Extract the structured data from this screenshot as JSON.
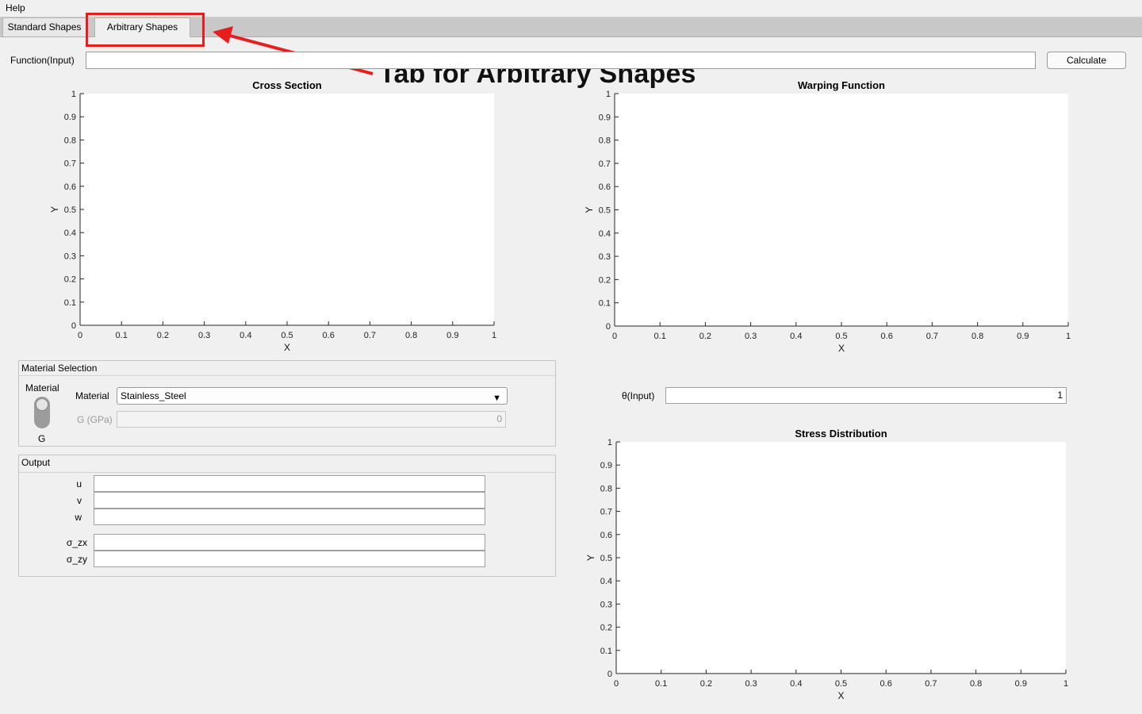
{
  "menu": {
    "help": "Help"
  },
  "tabs": [
    {
      "label": "Standard Shapes",
      "active": false
    },
    {
      "label": "Arbitrary Shapes",
      "active": true
    }
  ],
  "annotation": {
    "text": "Tab for Arbitrary Shapes",
    "color": "#e81e1e"
  },
  "function_input": {
    "label": "Function(Input)",
    "value": ""
  },
  "calculate_button": "Calculate",
  "ticks": [
    "0",
    "0.1",
    "0.2",
    "0.3",
    "0.4",
    "0.5",
    "0.6",
    "0.7",
    "0.8",
    "0.9",
    "1"
  ],
  "plots": {
    "cross_section": {
      "title": "Cross Section",
      "xlabel": "X",
      "ylabel": "Y"
    },
    "warping_function": {
      "title": "Warping Function",
      "xlabel": "X",
      "ylabel": "Y"
    },
    "stress_distribution": {
      "title": "Stress Distribution",
      "xlabel": "X",
      "ylabel": "Y"
    }
  },
  "material_panel": {
    "title": "Material Selection",
    "switch_top_label": "Material",
    "switch_bottom_label": "G",
    "material_label": "Material",
    "material_value": "Stainless_Steel",
    "g_label": "G (GPa)",
    "g_value": "0"
  },
  "theta": {
    "label": "θ(Input)",
    "value": "1"
  },
  "output_panel": {
    "title": "Output",
    "fields": [
      {
        "label": "u",
        "value": ""
      },
      {
        "label": "v",
        "value": ""
      },
      {
        "label": "w",
        "value": ""
      },
      {
        "label": "σ_zx",
        "value": ""
      },
      {
        "label": "σ_zy",
        "value": ""
      }
    ]
  },
  "colors": {
    "annotation_red": "#e81e1e",
    "window_bg": "#f0f0f0",
    "tabstrip_bg": "#c8c8c8"
  }
}
